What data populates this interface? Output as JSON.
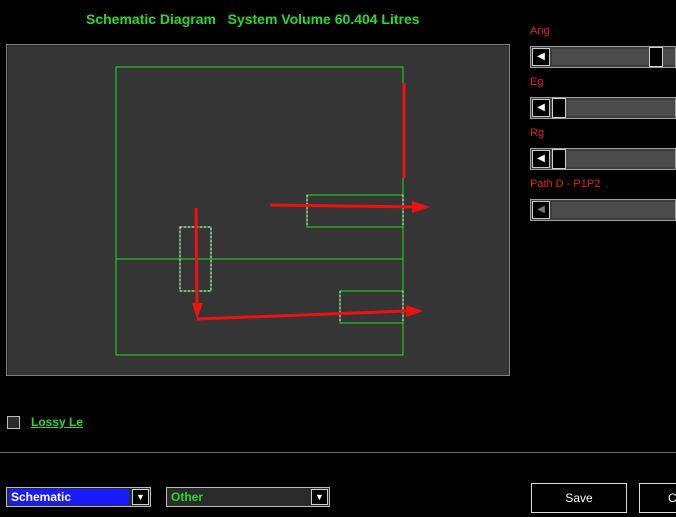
{
  "title": {
    "text": "Schematic Diagram   System Volume 60.404 Litres"
  },
  "sliders": [
    {
      "label": "Ang",
      "value_fraction": 0.95,
      "enabled": true
    },
    {
      "label": "Eg",
      "value_fraction": 0.0,
      "enabled": true
    },
    {
      "label": "Rg",
      "value_fraction": 0.0,
      "enabled": true
    },
    {
      "label": "Path  D - P1P2",
      "value_fraction": null,
      "enabled": false
    }
  ],
  "checkbox": {
    "label": "Lossy Le",
    "checked": false
  },
  "view_select": {
    "value": "Schematic",
    "highlight_color": "#1a1aff"
  },
  "type_select": {
    "value": "Other"
  },
  "buttons": {
    "save": "Save",
    "second": "C"
  },
  "colors": {
    "title": "#2bd92b",
    "schematic_lines": "#22dd22",
    "flow_arrows": "#ee1111",
    "slider_labels": "#e02020"
  }
}
